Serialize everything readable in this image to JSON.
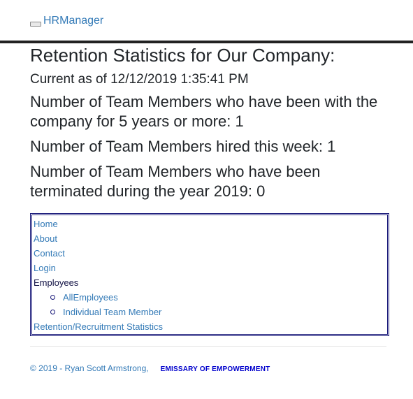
{
  "brand": {
    "label": "HRManager",
    "icon": "broken-image-icon"
  },
  "page": {
    "title": "Retention Statistics for Our Company:",
    "current": "Current as of 12/12/2019 1:35:41 PM",
    "stat_5_years": "Number of Team Members who have been with the company for 5 years or more: 1",
    "stat_hired_week": "Number of Team Members hired this week: 1",
    "stat_terminated": "Number of Team Members who have been terminated during the year 2019: 0"
  },
  "nav": {
    "home": "Home",
    "about": "About",
    "contact": "Contact",
    "login": "Login",
    "employees": "Employees",
    "all_employees": "AllEmployees",
    "individual": "Individual Team Member",
    "retention": "Retention/Recruitment Statistics"
  },
  "footer": {
    "copyright": "© 2019 - Ryan Scott Armstrong,",
    "tagline": "EMISSARY OF EMPOWERMENT"
  },
  "colors": {
    "link": "#337ab7",
    "border": "#1a1a7a",
    "tagline": "#0000cc"
  }
}
